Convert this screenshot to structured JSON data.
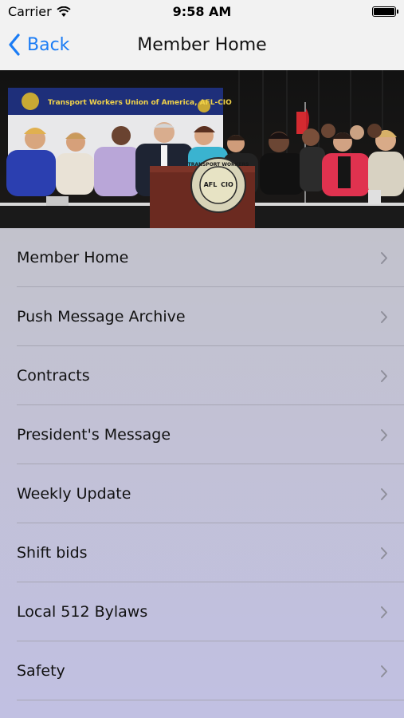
{
  "status_bar": {
    "carrier": "Carrier",
    "time": "9:58 AM"
  },
  "nav": {
    "back_label": "Back",
    "title": "Member Home"
  },
  "banner": {
    "org_text": "Transport Workers Union of America, AFL-CIO",
    "seal_text": "TRANSPORT WORKERS",
    "seal_afl": "AFL",
    "seal_cio": "CIO"
  },
  "menu": {
    "items": [
      {
        "label": "Member Home"
      },
      {
        "label": "Push Message Archive"
      },
      {
        "label": "Contracts"
      },
      {
        "label": "President's Message"
      },
      {
        "label": "Weekly Update"
      },
      {
        "label": "Shift bids"
      },
      {
        "label": "Local 512 Bylaws"
      },
      {
        "label": "Safety"
      }
    ]
  },
  "colors": {
    "accent": "#1a7cf5",
    "bar_background": "#f2f2f2",
    "list_background": "#c3c2df"
  }
}
